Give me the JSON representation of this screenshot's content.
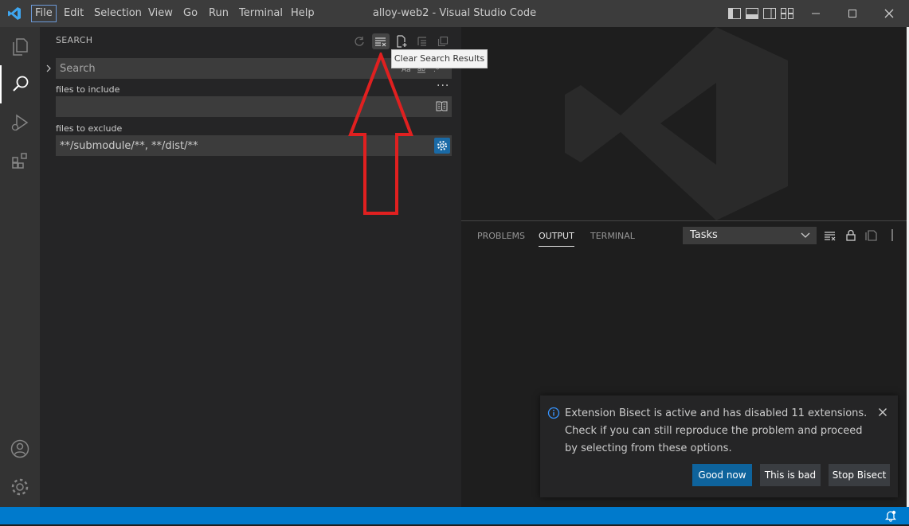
{
  "titlebar": {
    "menu": [
      "File",
      "Edit",
      "Selection",
      "View",
      "Go",
      "Run",
      "Terminal",
      "Help"
    ],
    "title": "alloy-web2 - Visual Studio Code"
  },
  "sidebar": {
    "title": "SEARCH",
    "search": {
      "placeholder": "Search"
    },
    "include": {
      "label": "files to include",
      "value": ""
    },
    "exclude": {
      "label": "files to exclude",
      "value": "**/submodule/**, **/dist/**"
    }
  },
  "tooltip": "Clear Search Results",
  "panel": {
    "tabs": [
      "PROBLEMS",
      "OUTPUT",
      "TERMINAL"
    ],
    "active_tab": "OUTPUT",
    "dropdown_value": "Tasks"
  },
  "notification": {
    "message": "Extension Bisect is active and has disabled 11 extensions. Check if you can still reproduce the problem and proceed by selecting from these options.",
    "buttons": {
      "good": "Good now",
      "bad": "This is bad",
      "stop": "Stop Bisect"
    }
  },
  "colors": {
    "accent": "#007acc",
    "primary_button": "#0e639c",
    "arrow": "#e02020"
  }
}
